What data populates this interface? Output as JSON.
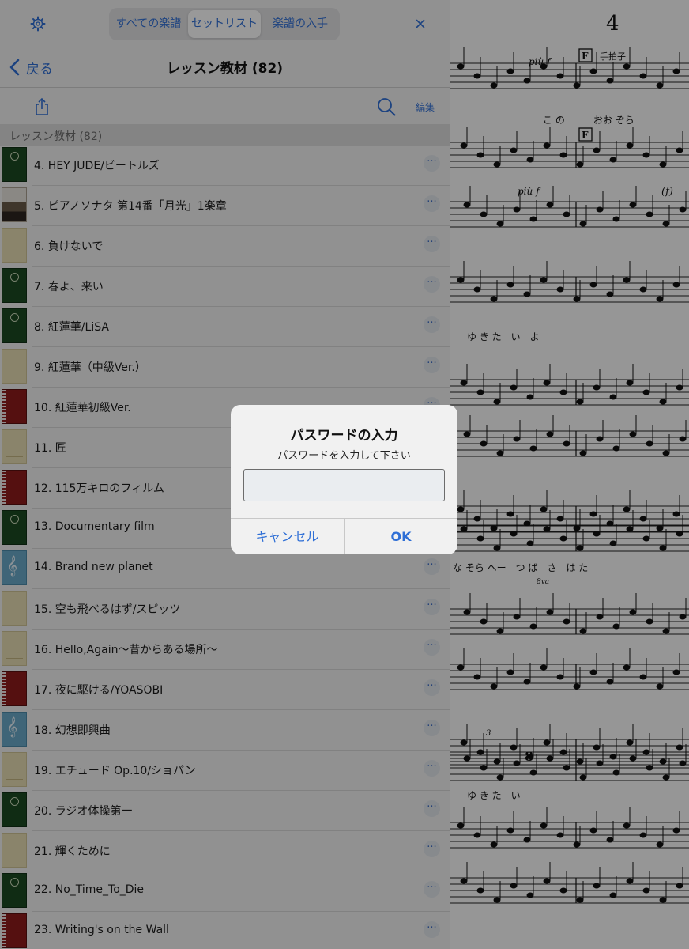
{
  "topbar": {
    "segments": [
      {
        "label": "すべての楽譜",
        "selected": false
      },
      {
        "label": "セットリスト",
        "selected": true
      },
      {
        "label": "楽譜の入手",
        "selected": false
      }
    ]
  },
  "nav": {
    "back_label": "戻る",
    "title": "レッスン教材 (82)"
  },
  "toolbar": {
    "edit_label": "編集"
  },
  "section_header": "レッスン教材 (82)",
  "items": [
    {
      "label": "4. HEY JUDE/ビートルズ",
      "thumb": "green"
    },
    {
      "label": "5. ピアノソナタ 第14番「月光」1楽章",
      "thumb": "photo"
    },
    {
      "label": "6. 負けないで",
      "thumb": "beige"
    },
    {
      "label": "7. 春よ、来い",
      "thumb": "green"
    },
    {
      "label": "8. 紅蓮華/LiSA",
      "thumb": "green"
    },
    {
      "label": "9. 紅蓮華（中級Ver.）",
      "thumb": "beige"
    },
    {
      "label": "10. 紅蓮華初級Ver.",
      "thumb": "red"
    },
    {
      "label": "11. 匠",
      "thumb": "beige"
    },
    {
      "label": "12. 115万キロのフィルム",
      "thumb": "red"
    },
    {
      "label": "13. Documentary film",
      "thumb": "green"
    },
    {
      "label": "14. Brand new planet",
      "thumb": "blue"
    },
    {
      "label": "15. 空も飛べるはず/スピッツ",
      "thumb": "beige"
    },
    {
      "label": "16. Hello,Again～昔からある場所～",
      "thumb": "beige"
    },
    {
      "label": "17. 夜に駆ける/YOASOBI",
      "thumb": "red"
    },
    {
      "label": "18. 幻想即興曲",
      "thumb": "blue"
    },
    {
      "label": "19. エチュード Op.10/ショパン",
      "thumb": "beige"
    },
    {
      "label": "20. ラジオ体操第一",
      "thumb": "green"
    },
    {
      "label": "21. 輝くために",
      "thumb": "beige"
    },
    {
      "label": "22. No_Time_To_Die",
      "thumb": "green"
    },
    {
      "label": "23. Writing's on the Wall",
      "thumb": "red"
    }
  ],
  "more_glyph": "···",
  "sheet": {
    "page_number": "4",
    "dynamic_1": "più f",
    "dynamic_2": "più f",
    "rehearsal_mark": "F",
    "tempo_text": "手拍子",
    "lyrics_1": "こ の　　　おお ぞら",
    "lyrics_2": "ゆ き た　い　よ",
    "lyrics_3": "な そら へー　つ ば　さ　は た",
    "lyrics_4": "ゆ き た　い",
    "dyn_f": "(f)",
    "ottava": "8va",
    "measure_8": "8",
    "triplet": "3"
  },
  "dialog": {
    "title": "パスワードの入力",
    "message": "パスワードを入力して下さい",
    "input_value": "",
    "cancel_label": "キャンセル",
    "ok_label": "OK"
  },
  "colors": {
    "accent": "#2f6fd6",
    "overlay": "rgba(0,0,0,0.40)",
    "panel_bg": "#f2f2f2"
  }
}
